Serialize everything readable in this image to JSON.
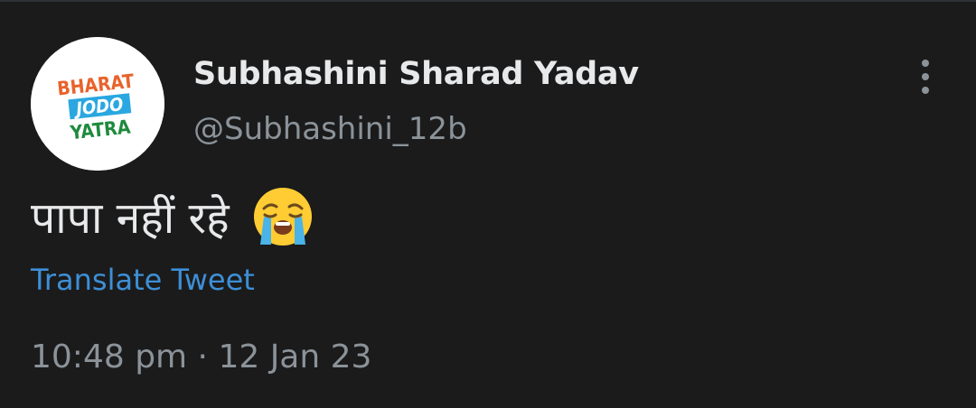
{
  "tweet": {
    "avatar": {
      "icon": "bharat-jodo-yatra-logo",
      "logo_lines": [
        "BHARAT",
        "JODO",
        "YATRA"
      ],
      "colors": {
        "bharat": "#e8632b",
        "jodo_band": "#2aa7e0",
        "yatra": "#1f8a3d"
      }
    },
    "author": {
      "display_name": "Subhashini Sharad Yadav",
      "handle": "@Subhashini_12b"
    },
    "more_icon": "more-vertical-icon",
    "text": "पापा नहीं रहे",
    "emoji_icon": "loudly-crying-face-icon",
    "translate_label": "Translate Tweet",
    "timestamp": "10:48 pm · 12 Jan 23"
  },
  "theme": {
    "background": "#1b1b1c",
    "primary_text": "#e7e9ea",
    "secondary_text": "#8b9399",
    "link": "#3d8fd6"
  }
}
